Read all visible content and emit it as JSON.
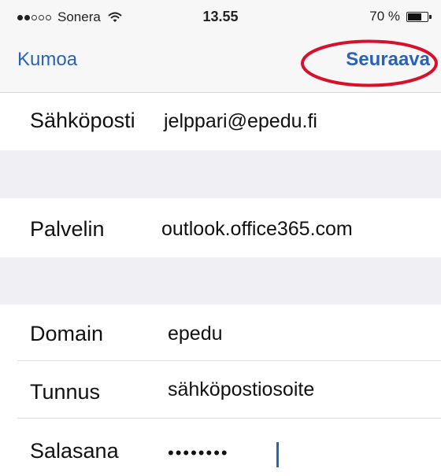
{
  "status_bar": {
    "carrier": "Sonera",
    "time": "13.55",
    "battery_text": "70 %",
    "battery_level": 0.7,
    "signal_bars_filled": 2,
    "signal_bars_total": 5
  },
  "nav": {
    "cancel_label": "Kumoa",
    "next_label": "Seuraava",
    "highlight_color": "#d8102a"
  },
  "form": {
    "email": {
      "label": "Sähköposti",
      "value": "jelppari@epedu.fi"
    },
    "server": {
      "label": "Palvelin",
      "value": "outlook.office365.com"
    },
    "domain": {
      "label": "Domain",
      "value": "epedu"
    },
    "username": {
      "label": "Tunnus",
      "value": "sähköpostiosoite"
    },
    "password": {
      "label": "Salasana",
      "value": "••••••••"
    }
  },
  "colors": {
    "accent": "#2a62b8",
    "group_background": "#efeff4"
  }
}
